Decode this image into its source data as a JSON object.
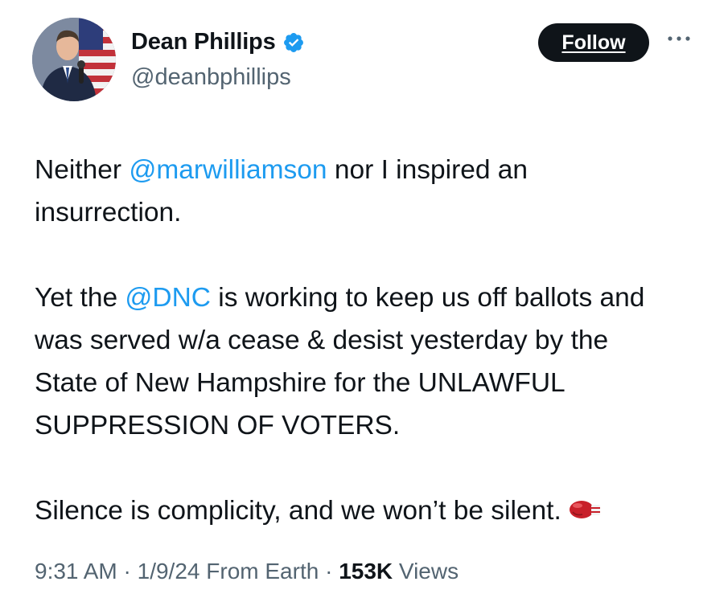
{
  "author": {
    "display_name": "Dean Phillips",
    "handle": "@deanbphillips",
    "verified": true,
    "avatar_icon": "person-avatar"
  },
  "actions": {
    "follow_label": "Follow",
    "more_icon": "ellipsis-icon"
  },
  "tweet": {
    "p1_before": "Neither ",
    "p1_mention": "@marwilliamson",
    "p1_after": " nor I inspired an insurrection.",
    "p2_before": "Yet the ",
    "p2_mention": "@DNC",
    "p2_after": " is working to keep us off ballots and was served w/a cease & desist yesterday by the State of New Hampshire for the UNLAWFUL SUPPRESSION OF VOTERS.",
    "p3_text": "Silence is complicity, and we won’t be silent.",
    "p3_emoji": "boxing-glove-icon"
  },
  "meta": {
    "time": "9:31 AM",
    "date": "1/9/24",
    "source": "From Earth",
    "separator": " · ",
    "views_count": "153K",
    "views_label": "Views"
  },
  "colors": {
    "text": "#0f1419",
    "secondary": "#536471",
    "link": "#1d9bf0",
    "verified": "#1d9bf0",
    "follow_bg": "#0f1419"
  }
}
